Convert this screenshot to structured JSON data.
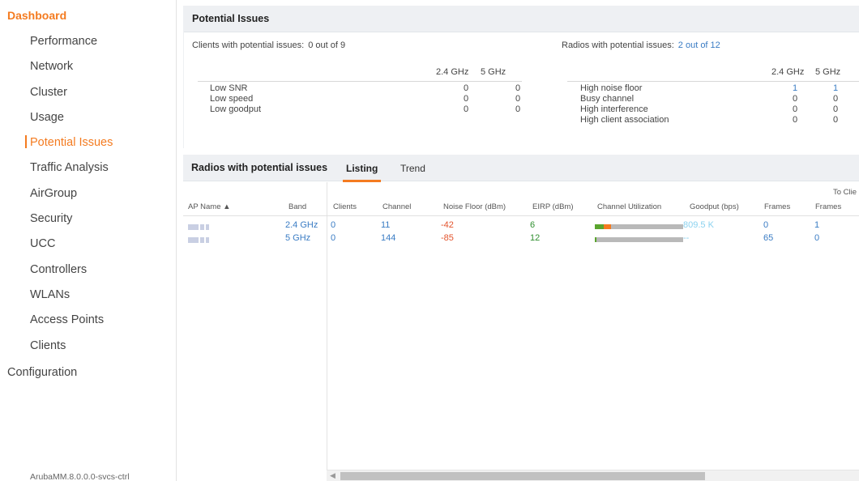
{
  "sidebar": {
    "dashboard": "Dashboard",
    "items": [
      {
        "label": "Performance"
      },
      {
        "label": "Network"
      },
      {
        "label": "Cluster"
      },
      {
        "label": "Usage"
      },
      {
        "label": "Potential Issues"
      },
      {
        "label": "Traffic Analysis"
      },
      {
        "label": "AirGroup"
      },
      {
        "label": "Security"
      },
      {
        "label": "UCC"
      },
      {
        "label": "Controllers"
      },
      {
        "label": "WLANs"
      },
      {
        "label": "Access Points"
      },
      {
        "label": "Clients"
      }
    ],
    "active_item": "Potential Issues",
    "configuration": "Configuration",
    "footer": "ArubaMM.8.0.0.0-svcs-ctrl"
  },
  "potential_issues": {
    "title": "Potential Issues",
    "clients": {
      "label": "Clients with potential issues:",
      "value": "0 out of 9",
      "col_24": "2.4 GHz",
      "col_5": "5 GHz",
      "rows": [
        {
          "name": "Low SNR",
          "v24": "0",
          "v5": "0"
        },
        {
          "name": "Low speed",
          "v24": "0",
          "v5": "0"
        },
        {
          "name": "Low goodput",
          "v24": "0",
          "v5": "0"
        }
      ]
    },
    "radios": {
      "label": "Radios with potential issues:",
      "value": "2 out of 12",
      "col_24": "2.4 GHz",
      "col_5": "5 GHz",
      "rows": [
        {
          "name": "High noise floor",
          "v24": "1",
          "v5": "1"
        },
        {
          "name": "Busy channel",
          "v24": "0",
          "v5": "0"
        },
        {
          "name": "High interference",
          "v24": "0",
          "v5": "0"
        },
        {
          "name": "High client association",
          "v24": "0",
          "v5": "0"
        }
      ]
    }
  },
  "radios_panel": {
    "title": "Radios with potential issues",
    "tabs": [
      "Listing",
      "Trend"
    ],
    "active_tab": "Listing",
    "group_header": "To Clie",
    "columns": [
      "AP Name ▲",
      "Band",
      "Clients",
      "Channel",
      "Noise Floor (dBm)",
      "EIRP (dBm)",
      "Channel Utilization",
      "Goodput (bps)",
      "Frames",
      "Frames"
    ],
    "rows": [
      {
        "band": "2.4 GHz",
        "clients": "0",
        "channel": "11",
        "noise": "-42",
        "eirp": "6",
        "util_green": 0.1,
        "util_orange": 0.08,
        "goodput": "809.5 K",
        "frames1": "0",
        "frames2": "1"
      },
      {
        "band": "5 GHz",
        "clients": "0",
        "channel": "144",
        "noise": "-85",
        "eirp": "12",
        "util_green": 0.01,
        "util_orange": 0.0,
        "goodput": "--",
        "frames1": "65",
        "frames2": "0"
      }
    ]
  },
  "colors": {
    "accent": "#f47b20",
    "link": "#3a7cc4",
    "noise": "#e3542d",
    "eirp": "#2f8f2f",
    "util_green": "#5aa52e",
    "goodput": "#8bd2ef"
  }
}
